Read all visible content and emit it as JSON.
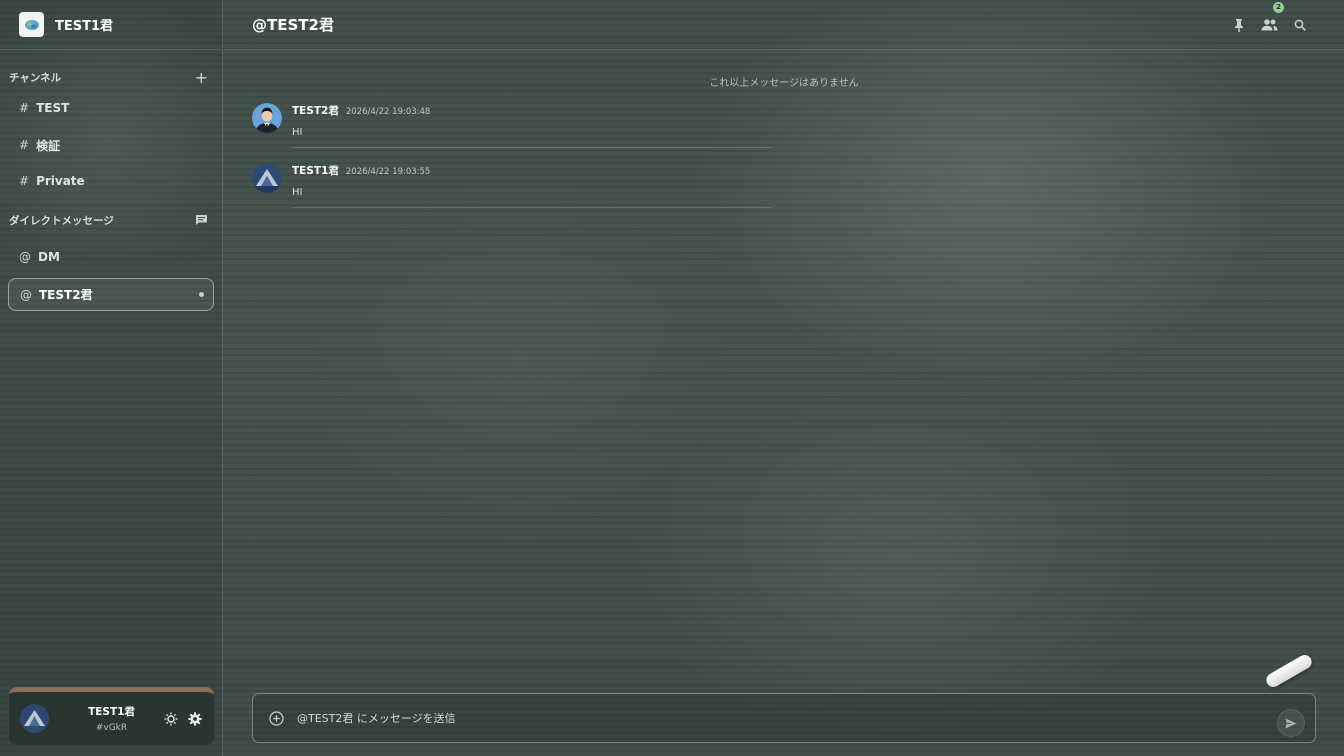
{
  "server": {
    "name": "TEST1君",
    "icon": "server-logo-icon"
  },
  "sidebar": {
    "channels_heading": "チャンネル",
    "channels": [
      {
        "prefix": "#",
        "label": "TEST"
      },
      {
        "prefix": "#",
        "label": "検証"
      },
      {
        "prefix": "#",
        "label": "Private"
      }
    ],
    "dm_heading": "ダイレクトメッセージ",
    "dms": [
      {
        "prefix": "@",
        "label": "DM"
      },
      {
        "prefix": "@",
        "label": "TEST2君",
        "active": true
      }
    ]
  },
  "user_panel": {
    "name": "TEST1君",
    "tag": "#vGkR"
  },
  "header": {
    "title": "@TEST2君",
    "member_badge": "2"
  },
  "messages_area": {
    "no_more": "これ以上メッセージはありません",
    "messages": [
      {
        "author": "TEST2君",
        "time": "2026/4/22 19:03:48",
        "text": "HI"
      },
      {
        "author": "TEST1君",
        "time": "2026/4/22 19:03:55",
        "text": "HI"
      }
    ]
  },
  "composer": {
    "placeholder": "@TEST2君 にメッセージを送信"
  },
  "colors": {
    "background": "#424f4a",
    "accent_badge": "#8fcf9a",
    "panel_stripe": "#8a6f5a"
  }
}
